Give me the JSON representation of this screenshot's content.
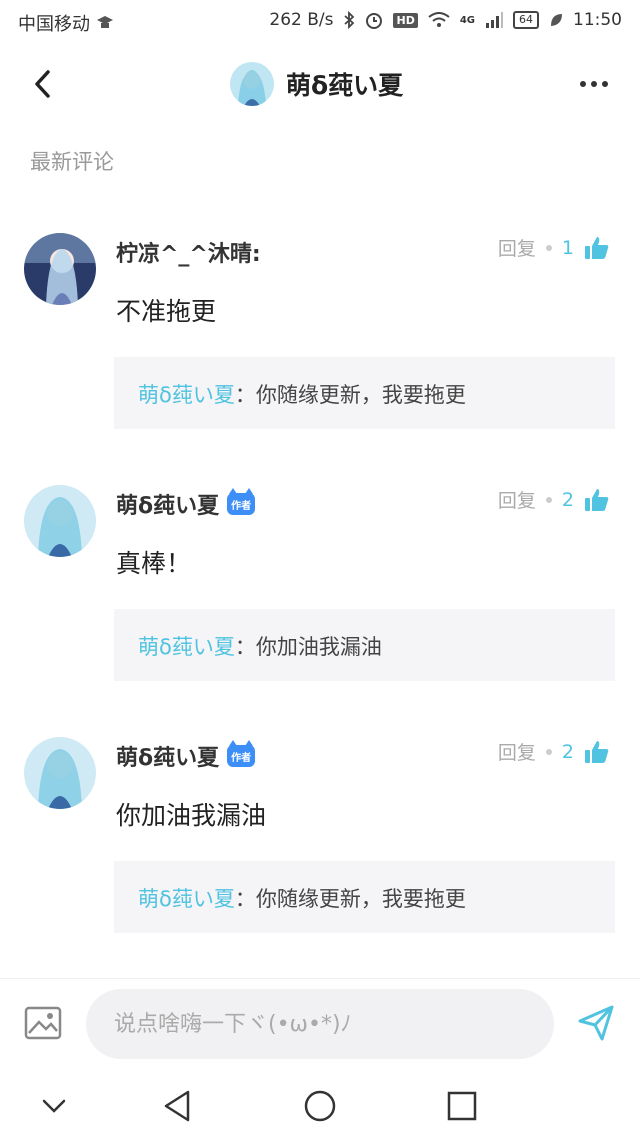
{
  "status_bar": {
    "carrier": "中国移动",
    "speed": "262 B/s",
    "network": "4G",
    "battery": "64",
    "time": "11:50"
  },
  "header": {
    "title": "萌δ莼い夏"
  },
  "section_title": "最新评论",
  "reply_label": "回复",
  "author_badge": "作者",
  "comments": [
    {
      "username": "柠凉^_^沐晴:",
      "is_author": false,
      "likes": "1",
      "content": "不准拖更",
      "reply": {
        "name": "萌δ莼い夏",
        "separator": "：",
        "text": "你随缘更新，我要拖更"
      }
    },
    {
      "username": "萌δ莼い夏",
      "is_author": true,
      "likes": "2",
      "content": "真棒！",
      "reply": {
        "name": "萌δ莼い夏",
        "separator": "：",
        "text": "你加油我漏油"
      }
    },
    {
      "username": "萌δ莼い夏",
      "is_author": true,
      "likes": "2",
      "content": "你加油我漏油",
      "reply": {
        "name": "萌δ莼い夏",
        "separator": "：",
        "text": "你随缘更新，我要拖更"
      }
    }
  ],
  "input": {
    "placeholder": "说点啥嗨一下ヾ(•ω•*)ﾉ"
  },
  "icons": {
    "back": "back-arrow-icon",
    "more": "more-dots-icon",
    "like": "thumb-up-icon",
    "image": "image-icon",
    "send": "send-icon"
  },
  "colors": {
    "accent": "#4fc3e0",
    "badge": "#3d8ef7",
    "reply_bg": "#f5f5f7"
  }
}
